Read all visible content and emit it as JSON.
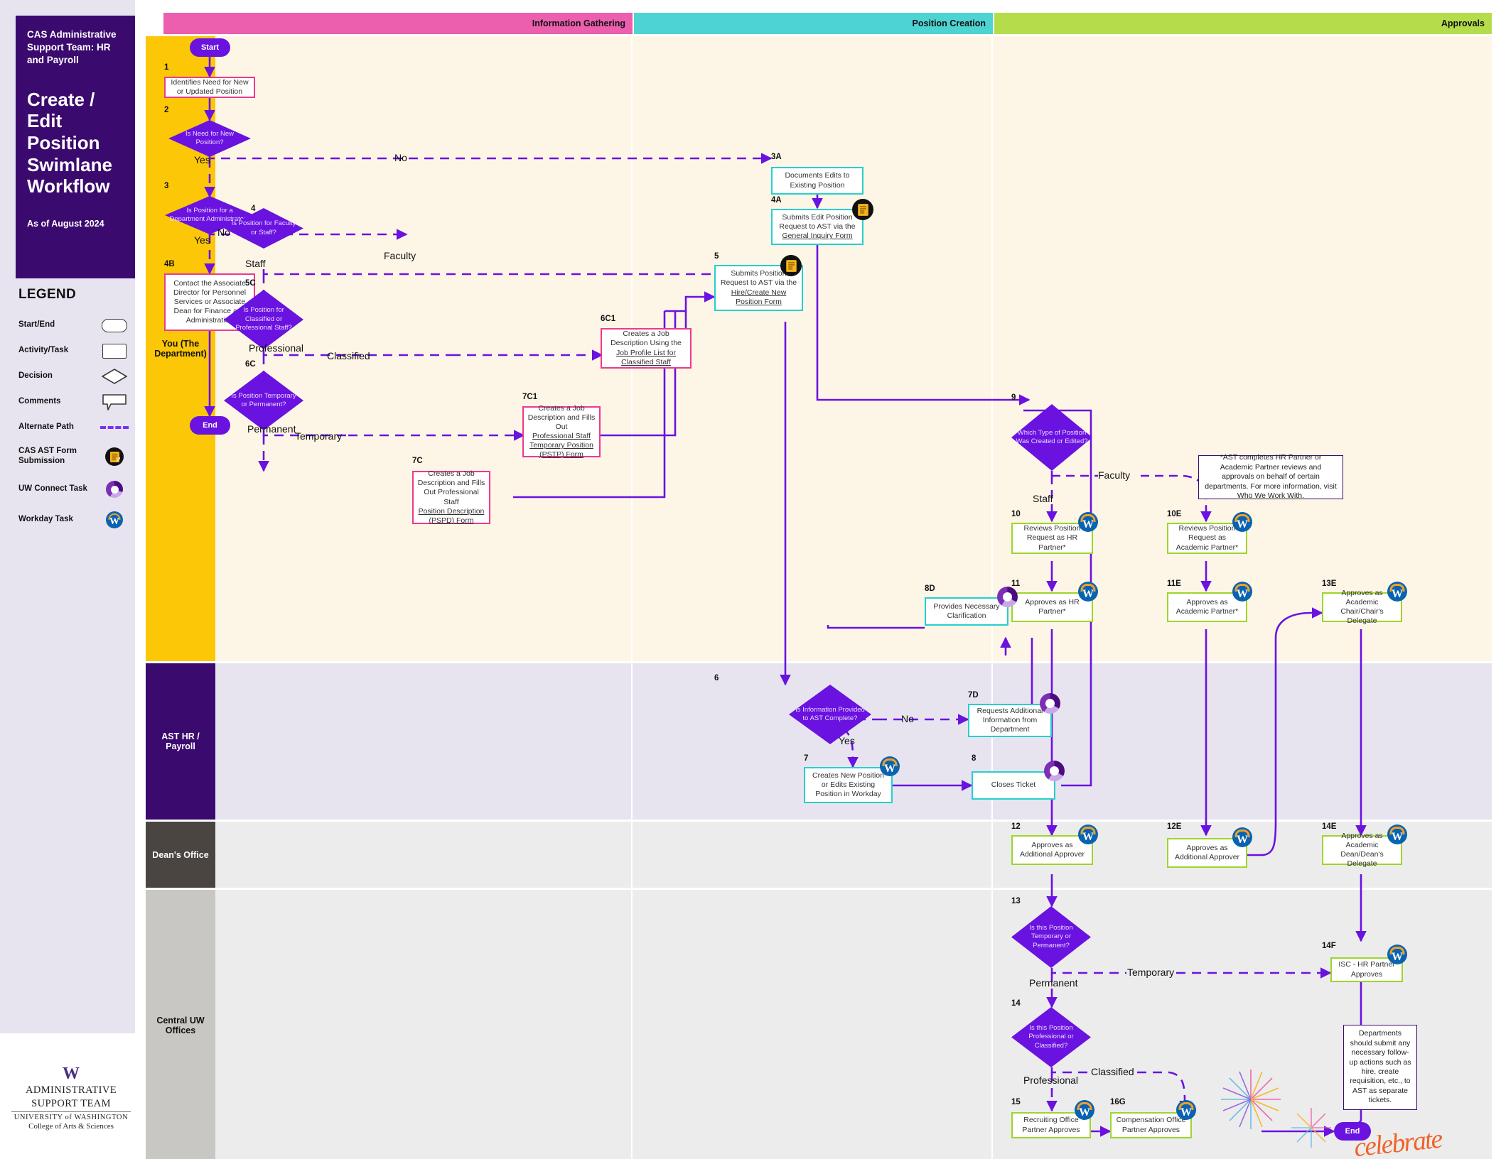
{
  "panel": {
    "org": "CAS Administrative Support Team: HR and Payroll",
    "title": "Create / Edit Position Swimlane Workflow",
    "asof": "As of August 2024",
    "legend_title": "LEGEND",
    "legend": [
      {
        "label": "Start/End",
        "icon": "rounded-rectangle-shape"
      },
      {
        "label": "Activity/Task",
        "icon": "rectangle-shape"
      },
      {
        "label": "Decision",
        "icon": "diamond-shape"
      },
      {
        "label": "Comments",
        "icon": "callout-shape"
      },
      {
        "label": "Alternate Path",
        "icon": "dashed-line"
      },
      {
        "label": "CAS AST Form Submission",
        "icon": "form-submission-icon"
      },
      {
        "label": "UW Connect Task",
        "icon": "uw-connect-icon"
      },
      {
        "label": "Workday Task",
        "icon": "workday-icon"
      }
    ],
    "logo": {
      "w": "W",
      "line1": "ADMINISTRATIVE",
      "line2": "SUPPORT TEAM",
      "line3": "UNIVERSITY of WASHINGTON",
      "line4": "College of Arts & Sciences"
    }
  },
  "columns": [
    {
      "label": "Information Gathering",
      "color": "#ec5fae"
    },
    {
      "label": "Position Creation",
      "color": "#4ed3d3"
    },
    {
      "label": "Approvals",
      "color": "#b5dd4b"
    }
  ],
  "lanes": [
    {
      "label": "You (The Department)",
      "header_color": "#fbc707",
      "body_color": "#fdf6e6"
    },
    {
      "label": "AST HR / Payroll",
      "header_color": "#3b0a6e",
      "body_color": "#e7e4f0"
    },
    {
      "label": "Dean's Office",
      "header_color": "#4a4540",
      "body_color": "#ececec"
    },
    {
      "label": "Central UW Offices",
      "header_color": "#c9c7c3",
      "body_color": "#ececec"
    }
  ],
  "terminators": {
    "start": "Start",
    "end": "End",
    "end2": "End"
  },
  "nodes": {
    "n1": {
      "tag": "1",
      "text": "Identifies Need for New or Updated Position"
    },
    "n2": {
      "tag": "2",
      "text": "Is Need for New Position?"
    },
    "n3": {
      "tag": "3",
      "text": "Is Position for a Department Administrator?"
    },
    "n4": {
      "tag": "4",
      "text": "Is Position for Faculty or Staff?"
    },
    "n4B": {
      "tag": "4B",
      "text": "Contact the Associate Director for Personnel Services or Associate Dean for Finance and Administration"
    },
    "n5C": {
      "tag": "5C",
      "text": "Is Position for Classified or Professional Staff?"
    },
    "n6C": {
      "tag": "6C",
      "text": "Is Position Temporary or Permanent?"
    },
    "n6C1": {
      "tag": "6C1",
      "text_pre": "Creates a Job Description Using the ",
      "link": "Job Profile List for Classified Staff",
      "text_post": ""
    },
    "n7C": {
      "tag": "7C",
      "text_pre": "Creates a Job Description and Fills Out Professional Staff ",
      "link": "Position Description (PSPD) Form",
      "text_post": ""
    },
    "n7C1": {
      "tag": "7C1",
      "text_pre": "Creates a Job Description and Fills Out ",
      "link": "Professional Staff Temporary Position (PSTP) Form",
      "text_post": ""
    },
    "n3A": {
      "tag": "3A",
      "text": "Documents Edits to Existing Position"
    },
    "n4A": {
      "tag": "4A",
      "text_pre": "Submits Edit Position Request to AST via the ",
      "link": "General Inquiry Form",
      "text_post": ""
    },
    "n5": {
      "tag": "5",
      "text_pre": "Submits Position Request to AST via the ",
      "link": "Hire/Create New Position Form",
      "text_post": ""
    },
    "n6": {
      "tag": "6",
      "text": "Is Information Provided to AST Complete?"
    },
    "n7": {
      "tag": "7",
      "text": "Creates New Position or Edits Existing Position in Workday"
    },
    "n7D": {
      "tag": "7D",
      "text": "Requests Additional Information from Department"
    },
    "n8": {
      "tag": "8",
      "text": "Closes Ticket"
    },
    "n8D": {
      "tag": "8D",
      "text": "Provides Necessary Clarification"
    },
    "n9": {
      "tag": "9",
      "text": "Which Type of Position Was Created or Edited?"
    },
    "n10": {
      "tag": "10",
      "text": "Reviews Position Request as HR Partner*"
    },
    "n10E": {
      "tag": "10E",
      "text": "Reviews Position Request as Academic Partner*"
    },
    "n11": {
      "tag": "11",
      "text": "Approves as HR Partner*"
    },
    "n11E": {
      "tag": "11E",
      "text": "Approves as Academic Partner*"
    },
    "n13E": {
      "tag": "13E",
      "text": "Approves as Academic Chair/Chair's Delegate"
    },
    "n12": {
      "tag": "12",
      "text": "Approves as Additional Approver"
    },
    "n12E": {
      "tag": "12E",
      "text": "Approves as Additional Approver"
    },
    "n14E": {
      "tag": "14E",
      "text": "Approves as Academic Dean/Dean's Delegate"
    },
    "n13": {
      "tag": "13",
      "text": "Is this Position Temporary or Permanent?"
    },
    "n14": {
      "tag": "14",
      "text": "Is this Position Professional or Classified?"
    },
    "n14F": {
      "tag": "14F",
      "text": "ISC - HR Partner Approves"
    },
    "n15": {
      "tag": "15",
      "text": "Recruiting Office Partner Approves"
    },
    "n16G": {
      "tag": "16G",
      "text": "Compensation Office Partner Approves"
    }
  },
  "comments": {
    "c1_pre": "*AST completes HR Partner or Academic Partner reviews and approvals on behalf of certain departments. For more information, visit ",
    "c1_link": "Who We Work With",
    "c1_post": ".",
    "c2": "Departments should submit any necessary follow-up actions such as hire, create requisition, etc., to AST as separate tickets."
  },
  "edge_labels": {
    "no1": "No",
    "yes1": "Yes",
    "no2": "No",
    "yes2": "Yes",
    "faculty1": "Faculty",
    "staff1": "Staff",
    "classified1": "Classified",
    "professional1": "Professional",
    "temporary1": "Temporary",
    "permanent1": "Permanent",
    "no3": "No",
    "yes3": "Yes",
    "faculty2": "Faculty",
    "staff2": "Staff",
    "temporary2": "Temporary",
    "permanent2": "Permanent",
    "classified2": "Classified",
    "professional2": "Professional"
  },
  "colors": {
    "purple": "#6a12e0",
    "pink_border": "#ec3a8e",
    "teal_border": "#27cfcf",
    "green_border": "#9cd62b",
    "deep_purple": "#3b0a6e",
    "gold": "#fbc707"
  },
  "celebrate_word": "celebrate"
}
